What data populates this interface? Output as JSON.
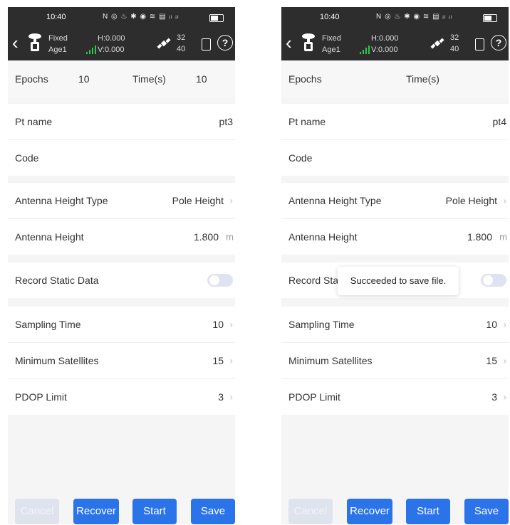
{
  "colors": {
    "header_bg": "#2d2d2d",
    "accent": "#2a73e8",
    "cancel_disabled": "#dfe3ee",
    "signal": "#2fc84a"
  },
  "screens": [
    {
      "status": {
        "time": "10:40",
        "icons": "N ◎ ♨ ✱ ◉ ≋ ▤ ᵢₗ ᵢₗ"
      },
      "header": {
        "fix": "Fixed",
        "age": "Age1",
        "h": "H:0.000",
        "v": "V:0.000",
        "sat_used": "32",
        "sat_total": "40",
        "back_icon": "chevron-left-icon",
        "help_icon": "help-icon"
      },
      "epochs": {
        "label": "Epochs",
        "value": "10",
        "time_label": "Time(s)",
        "time_value": "10"
      },
      "fields": {
        "pt_name": {
          "label": "Pt name",
          "value": "pt3"
        },
        "code": {
          "label": "Code",
          "value": ""
        },
        "antenna_type": {
          "label": "Antenna Height Type",
          "value": "Pole Height"
        },
        "antenna_height": {
          "label": "Antenna Height",
          "value": "1.800",
          "unit": "m"
        },
        "record_static": {
          "label": "Record Static Data",
          "on": false
        },
        "sampling": {
          "label": "Sampling Time",
          "value": "10"
        },
        "min_sats": {
          "label": "Minimum Satellites",
          "value": "15"
        },
        "pdop": {
          "label": "PDOP Limit",
          "value": "3"
        }
      },
      "buttons": {
        "cancel": "Cancel",
        "recover": "Recover",
        "start": "Start",
        "save": "Save"
      },
      "toast": ""
    },
    {
      "status": {
        "time": "10:40",
        "icons": "N ◎ ♨ ✱ ◉ ≋ ▤ ᵢₗ ᵢₗ"
      },
      "header": {
        "fix": "Fixed",
        "age": "Age1",
        "h": "H:0.000",
        "v": "V:0.000",
        "sat_used": "32",
        "sat_total": "40",
        "back_icon": "chevron-left-icon",
        "help_icon": "help-icon"
      },
      "epochs": {
        "label": "Epochs",
        "value": "",
        "time_label": "Time(s)",
        "time_value": ""
      },
      "fields": {
        "pt_name": {
          "label": "Pt name",
          "value": "pt4"
        },
        "code": {
          "label": "Code",
          "value": ""
        },
        "antenna_type": {
          "label": "Antenna Height Type",
          "value": "Pole Height"
        },
        "antenna_height": {
          "label": "Antenna Height",
          "value": "1.800",
          "unit": "m"
        },
        "record_static": {
          "label": "Record Sta",
          "on": false
        },
        "sampling": {
          "label": "Sampling Time",
          "value": "10"
        },
        "min_sats": {
          "label": "Minimum Satellites",
          "value": "15"
        },
        "pdop": {
          "label": "PDOP Limit",
          "value": "3"
        }
      },
      "buttons": {
        "cancel": "Cancel",
        "recover": "Recover",
        "start": "Start",
        "save": "Save"
      },
      "toast": "Succeeded to save file."
    }
  ]
}
